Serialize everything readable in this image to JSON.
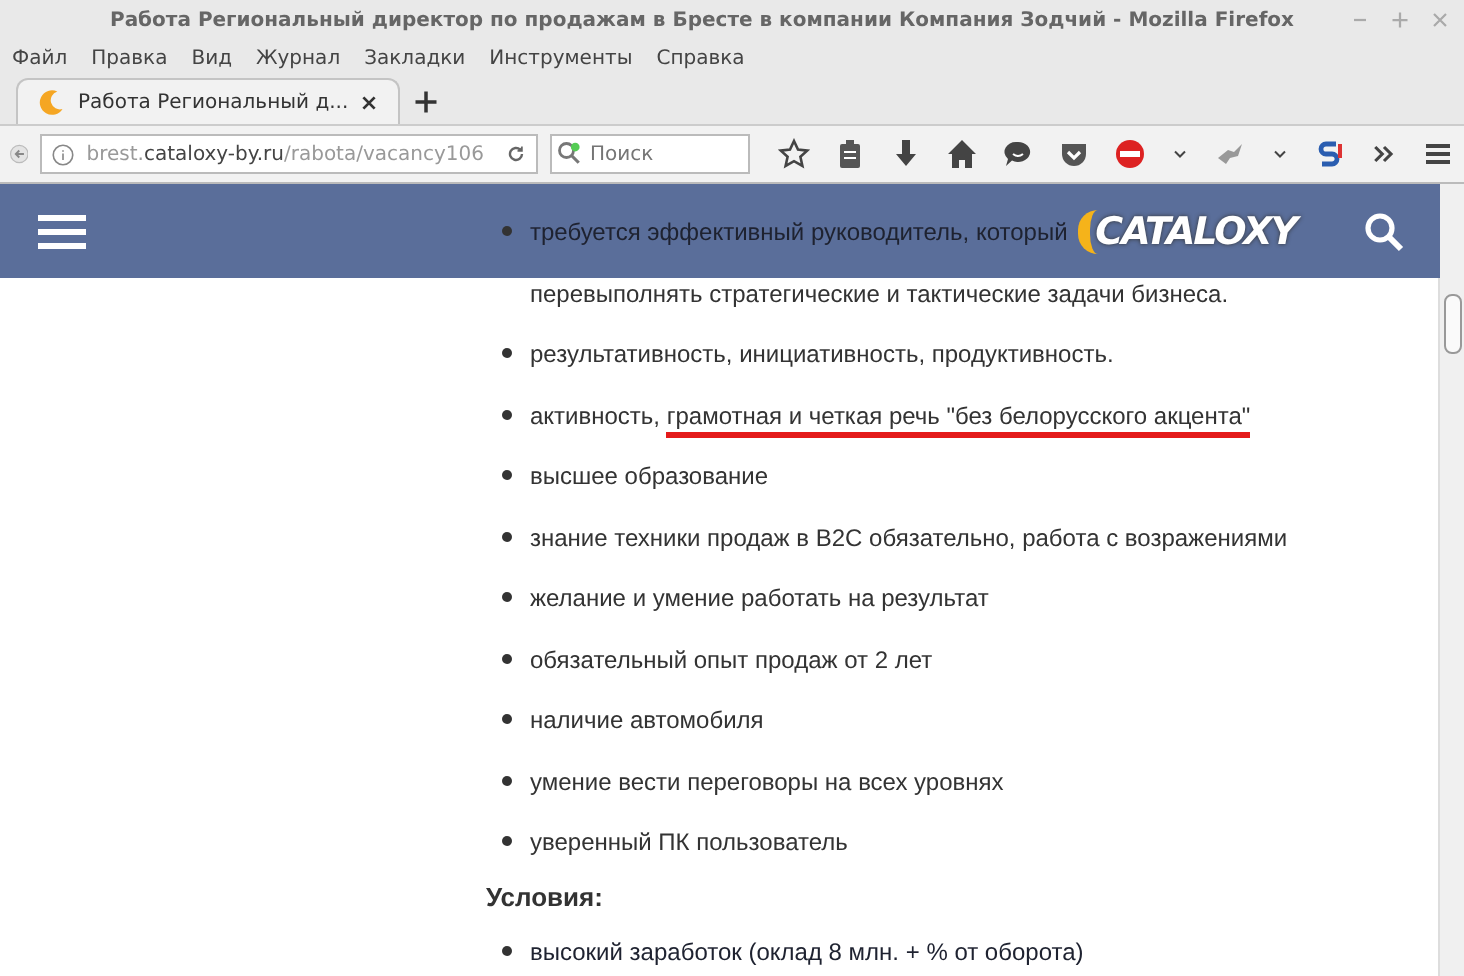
{
  "window": {
    "title": "Работа Региональный директор по продажам в Бресте в компании Компания Зодчий - Mozilla Firefox"
  },
  "menu": [
    {
      "label": "Файл"
    },
    {
      "label": "Правка"
    },
    {
      "label": "Вид"
    },
    {
      "label": "Журнал"
    },
    {
      "label": "Закладки"
    },
    {
      "label": "Инструменты"
    },
    {
      "label": "Справка"
    }
  ],
  "tabs": [
    {
      "label": "Работа Региональный д...",
      "selected": true
    }
  ],
  "address_bar": {
    "host_prefix": "brest.",
    "domain": "cataloxy-by.ru",
    "path": "/rabota/vacancy106"
  },
  "search": {
    "placeholder": "Поиск"
  },
  "site_header": {
    "logo": "CATALOXY"
  },
  "requirements": [
    {
      "text": "требуется эффективный руководитель, который",
      "continuation": "перевыполнять стратегические и тактические задачи бизнеса."
    },
    {
      "text": "результативность, инициативность, продуктивность."
    },
    {
      "text": "активность, ",
      "underlined": "грамотная и четкая речь \"без белорусского акцента\""
    },
    {
      "text": "высшее образование"
    },
    {
      "text": "знание техники продаж в B2C обязательно, работа с возражениями"
    },
    {
      "text": "желание и умение работать на результат"
    },
    {
      "text": "обязательный опыт продаж от 2 лет"
    },
    {
      "text": "наличие автомобиля"
    },
    {
      "text": "умение вести переговоры на всех уровнях"
    },
    {
      "text": "уверенный ПК пользователь"
    }
  ],
  "conditions_title": "Условия:",
  "conditions": [
    {
      "text": "высокий заработок (оклад 8 млн. + % от оборота)"
    }
  ]
}
